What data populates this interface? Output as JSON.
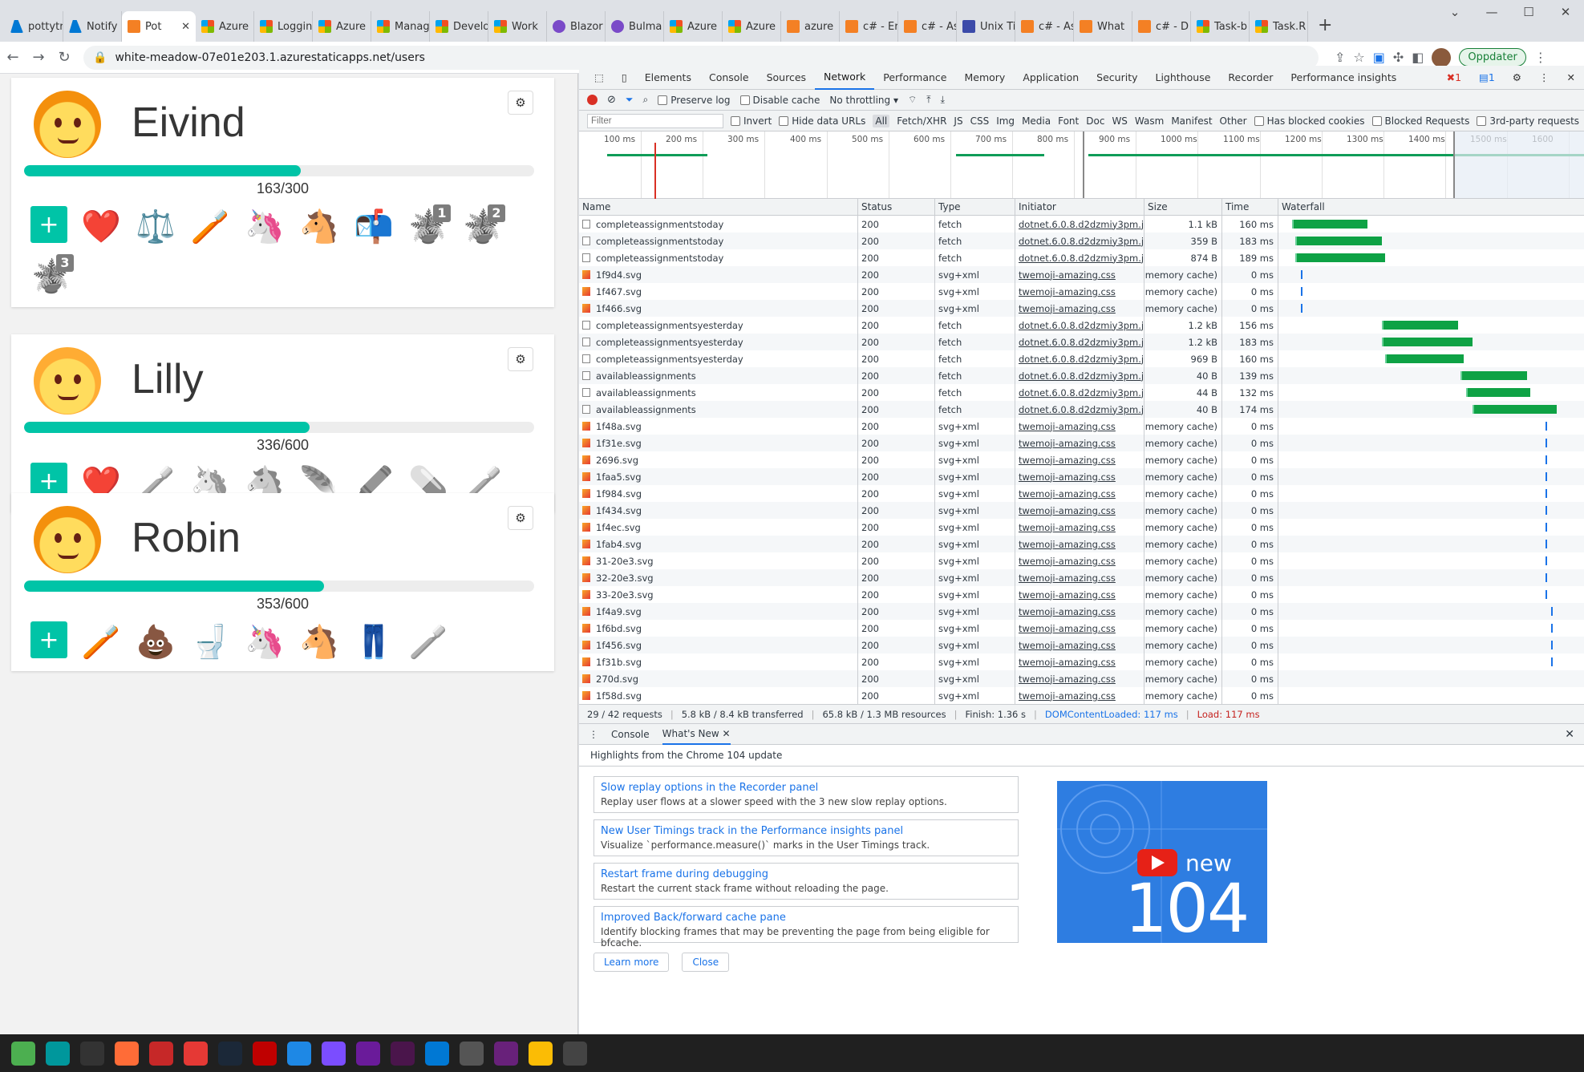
{
  "tabs": [
    {
      "label": "pottytr",
      "icon": "azure-icon"
    },
    {
      "label": "Notify",
      "icon": "azure-icon"
    },
    {
      "label": "Pot",
      "icon": "poop-icon",
      "active": true
    },
    {
      "label": "Azure",
      "icon": "microsoft-icon"
    },
    {
      "label": "Loggin",
      "icon": "microsoft-icon"
    },
    {
      "label": "Azure",
      "icon": "microsoft-icon"
    },
    {
      "label": "Manag",
      "icon": "microsoft-icon"
    },
    {
      "label": "Develo",
      "icon": "microsoft-icon"
    },
    {
      "label": "Work",
      "icon": "microsoft-icon"
    },
    {
      "label": "Blazor",
      "icon": "blazor-icon"
    },
    {
      "label": "Bulma",
      "icon": "bulma-icon"
    },
    {
      "label": "Azure",
      "icon": "microsoft-icon"
    },
    {
      "label": "Azure",
      "icon": "microsoft-icon"
    },
    {
      "label": "azure",
      "icon": "stackoverflow-icon"
    },
    {
      "label": "c# - Er",
      "icon": "stackoverflow-icon"
    },
    {
      "label": "c# - As",
      "icon": "stackoverflow-icon"
    },
    {
      "label": "Unix Ti",
      "icon": "unix-icon"
    },
    {
      "label": "c# - As",
      "icon": "stackoverflow-icon"
    },
    {
      "label": "What",
      "icon": "stackoverflow-icon"
    },
    {
      "label": "c# - D",
      "icon": "stackoverflow-icon"
    },
    {
      "label": "Task-b",
      "icon": "microsoft-icon"
    },
    {
      "label": "Task.R",
      "icon": "microsoft-icon"
    }
  ],
  "url": "white-meadow-07e01e203.1.azurestaticapps.net/users",
  "update_label": "Oppdater",
  "users": [
    {
      "name": "Eivind",
      "score": "163/300",
      "progress": 0.543,
      "hair": "#f4900c",
      "icons": [
        "heart-sun",
        "balance-scale",
        "toothbrush",
        "unicorn",
        "horse",
        "mailbox",
        "potty-1",
        "potty-2",
        "potty-3"
      ]
    },
    {
      "name": "Lilly",
      "score": "336/600",
      "progress": 0.56,
      "hair": "#ffac33",
      "icons": [
        "heart-sun",
        "toothbrush-gray",
        "unicorn-gray",
        "horse-gray",
        "feather-gray",
        "crayon-gray",
        "pill-gray",
        "toothbrush-gray-2"
      ]
    },
    {
      "name": "Robin",
      "score": "353/600",
      "progress": 0.588,
      "hair": "#f4900c",
      "icons": [
        "toothbrush",
        "poop",
        "toilet",
        "unicorn",
        "horse",
        "jeans",
        "toothbrush-gray-2"
      ]
    }
  ],
  "devtools": {
    "tabs": [
      "Elements",
      "Console",
      "Sources",
      "Network",
      "Performance",
      "Memory",
      "Application",
      "Security",
      "Lighthouse",
      "Recorder",
      "Performance insights"
    ],
    "active_tab": "Network",
    "errors": "1",
    "messages": "1",
    "preserve_log": "Preserve log",
    "disable_cache": "Disable cache",
    "throttling": "No throttling",
    "filter_placeholder": "Filter",
    "invert": "Invert",
    "hide_data": "Hide data URLs",
    "types": [
      "All",
      "Fetch/XHR",
      "JS",
      "CSS",
      "Img",
      "Media",
      "Font",
      "Doc",
      "WS",
      "Wasm",
      "Manifest",
      "Other"
    ],
    "has_blocked": "Has blocked cookies",
    "blocked_req": "Blocked Requests",
    "third_party": "3rd-party requests",
    "timeline_ticks": [
      "100 ms",
      "200 ms",
      "300 ms",
      "400 ms",
      "500 ms",
      "600 ms",
      "700 ms",
      "800 ms",
      "900 ms",
      "1000 ms",
      "1100 ms",
      "1200 ms",
      "1300 ms",
      "1400 ms",
      "1500 ms",
      "1600"
    ],
    "columns": [
      "Name",
      "Status",
      "Type",
      "Initiator",
      "Size",
      "Time",
      "Waterfall"
    ],
    "rows": [
      {
        "name": "completeassignmentstoday",
        "status": "200",
        "type": "fetch",
        "initiator": "dotnet.6.0.8.d2dzmiy3pm.j...",
        "size": "1.1 kB",
        "time": "160 ms",
        "start": 0.02,
        "dur": 0.26,
        "kind": "doc"
      },
      {
        "name": "completeassignmentstoday",
        "status": "200",
        "type": "fetch",
        "initiator": "dotnet.6.0.8.d2dzmiy3pm.j...",
        "size": "359 B",
        "time": "183 ms",
        "start": 0.03,
        "dur": 0.3,
        "kind": "doc"
      },
      {
        "name": "completeassignmentstoday",
        "status": "200",
        "type": "fetch",
        "initiator": "dotnet.6.0.8.d2dzmiy3pm.j...",
        "size": "874 B",
        "time": "189 ms",
        "start": 0.03,
        "dur": 0.31,
        "kind": "doc"
      },
      {
        "name": "1f9d4.svg",
        "status": "200",
        "type": "svg+xml",
        "initiator": "twemoji-amazing.css",
        "size": "(memory cache)",
        "time": "0 ms",
        "start": 0.04,
        "dur": 0,
        "kind": "img"
      },
      {
        "name": "1f467.svg",
        "status": "200",
        "type": "svg+xml",
        "initiator": "twemoji-amazing.css",
        "size": "(memory cache)",
        "time": "0 ms",
        "start": 0.04,
        "dur": 0,
        "kind": "img"
      },
      {
        "name": "1f466.svg",
        "status": "200",
        "type": "svg+xml",
        "initiator": "twemoji-amazing.css",
        "size": "(memory cache)",
        "time": "0 ms",
        "start": 0.04,
        "dur": 0,
        "kind": "img"
      },
      {
        "name": "completeassignmentsyesterday",
        "status": "200",
        "type": "fetch",
        "initiator": "dotnet.6.0.8.d2dzmiy3pm.j...",
        "size": "1.2 kB",
        "time": "156 ms",
        "start": 0.33,
        "dur": 0.26,
        "kind": "doc"
      },
      {
        "name": "completeassignmentsyesterday",
        "status": "200",
        "type": "fetch",
        "initiator": "dotnet.6.0.8.d2dzmiy3pm.j...",
        "size": "1.2 kB",
        "time": "183 ms",
        "start": 0.33,
        "dur": 0.31,
        "kind": "doc"
      },
      {
        "name": "completeassignmentsyesterday",
        "status": "200",
        "type": "fetch",
        "initiator": "dotnet.6.0.8.d2dzmiy3pm.j...",
        "size": "969 B",
        "time": "160 ms",
        "start": 0.34,
        "dur": 0.27,
        "kind": "doc"
      },
      {
        "name": "availableassignments",
        "status": "200",
        "type": "fetch",
        "initiator": "dotnet.6.0.8.d2dzmiy3pm.j...",
        "size": "40 B",
        "time": "139 ms",
        "start": 0.6,
        "dur": 0.23,
        "kind": "doc"
      },
      {
        "name": "availableassignments",
        "status": "200",
        "type": "fetch",
        "initiator": "dotnet.6.0.8.d2dzmiy3pm.j...",
        "size": "44 B",
        "time": "132 ms",
        "start": 0.62,
        "dur": 0.22,
        "kind": "doc"
      },
      {
        "name": "availableassignments",
        "status": "200",
        "type": "fetch",
        "initiator": "dotnet.6.0.8.d2dzmiy3pm.j...",
        "size": "40 B",
        "time": "174 ms",
        "start": 0.64,
        "dur": 0.29,
        "kind": "doc"
      },
      {
        "name": "1f48a.svg",
        "status": "200",
        "type": "svg+xml",
        "initiator": "twemoji-amazing.css",
        "size": "(memory cache)",
        "time": "0 ms",
        "start": 0.88,
        "dur": 0,
        "kind": "img"
      },
      {
        "name": "1f31e.svg",
        "status": "200",
        "type": "svg+xml",
        "initiator": "twemoji-amazing.css",
        "size": "(memory cache)",
        "time": "0 ms",
        "start": 0.88,
        "dur": 0,
        "kind": "img"
      },
      {
        "name": "2696.svg",
        "status": "200",
        "type": "svg+xml",
        "initiator": "twemoji-amazing.css",
        "size": "(memory cache)",
        "time": "0 ms",
        "start": 0.88,
        "dur": 0,
        "kind": "img"
      },
      {
        "name": "1faa5.svg",
        "status": "200",
        "type": "svg+xml",
        "initiator": "twemoji-amazing.css",
        "size": "(memory cache)",
        "time": "0 ms",
        "start": 0.88,
        "dur": 0,
        "kind": "img"
      },
      {
        "name": "1f984.svg",
        "status": "200",
        "type": "svg+xml",
        "initiator": "twemoji-amazing.css",
        "size": "(memory cache)",
        "time": "0 ms",
        "start": 0.88,
        "dur": 0,
        "kind": "img"
      },
      {
        "name": "1f434.svg",
        "status": "200",
        "type": "svg+xml",
        "initiator": "twemoji-amazing.css",
        "size": "(memory cache)",
        "time": "0 ms",
        "start": 0.88,
        "dur": 0,
        "kind": "img"
      },
      {
        "name": "1f4ec.svg",
        "status": "200",
        "type": "svg+xml",
        "initiator": "twemoji-amazing.css",
        "size": "(memory cache)",
        "time": "0 ms",
        "start": 0.88,
        "dur": 0,
        "kind": "img"
      },
      {
        "name": "1fab4.svg",
        "status": "200",
        "type": "svg+xml",
        "initiator": "twemoji-amazing.css",
        "size": "(memory cache)",
        "time": "0 ms",
        "start": 0.88,
        "dur": 0,
        "kind": "img"
      },
      {
        "name": "31-20e3.svg",
        "status": "200",
        "type": "svg+xml",
        "initiator": "twemoji-amazing.css",
        "size": "(memory cache)",
        "time": "0 ms",
        "start": 0.88,
        "dur": 0,
        "kind": "img"
      },
      {
        "name": "32-20e3.svg",
        "status": "200",
        "type": "svg+xml",
        "initiator": "twemoji-amazing.css",
        "size": "(memory cache)",
        "time": "0 ms",
        "start": 0.88,
        "dur": 0,
        "kind": "img"
      },
      {
        "name": "33-20e3.svg",
        "status": "200",
        "type": "svg+xml",
        "initiator": "twemoji-amazing.css",
        "size": "(memory cache)",
        "time": "0 ms",
        "start": 0.88,
        "dur": 0,
        "kind": "img"
      },
      {
        "name": "1f4a9.svg",
        "status": "200",
        "type": "svg+xml",
        "initiator": "twemoji-amazing.css",
        "size": "(memory cache)",
        "time": "0 ms",
        "start": 0.9,
        "dur": 0,
        "kind": "img"
      },
      {
        "name": "1f6bd.svg",
        "status": "200",
        "type": "svg+xml",
        "initiator": "twemoji-amazing.css",
        "size": "(memory cache)",
        "time": "0 ms",
        "start": 0.9,
        "dur": 0,
        "kind": "img"
      },
      {
        "name": "1f456.svg",
        "status": "200",
        "type": "svg+xml",
        "initiator": "twemoji-amazing.css",
        "size": "(memory cache)",
        "time": "0 ms",
        "start": 0.9,
        "dur": 0,
        "kind": "img"
      },
      {
        "name": "1f31b.svg",
        "status": "200",
        "type": "svg+xml",
        "initiator": "twemoji-amazing.css",
        "size": "(memory cache)",
        "time": "0 ms",
        "start": 0.9,
        "dur": 0,
        "kind": "img"
      },
      {
        "name": "270d.svg",
        "status": "200",
        "type": "svg+xml",
        "initiator": "twemoji-amazing.css",
        "size": "(memory cache)",
        "time": "0 ms",
        "start": 0.99,
        "dur": 0,
        "kind": "img"
      },
      {
        "name": "1f58d.svg",
        "status": "200",
        "type": "svg+xml",
        "initiator": "twemoji-amazing.css",
        "size": "(memory cache)",
        "time": "0 ms",
        "start": 0.99,
        "dur": 0,
        "kind": "img"
      }
    ],
    "summary": {
      "requests": "29 / 42 requests",
      "transferred": "5.8 kB / 8.4 kB transferred",
      "resources": "65.8 kB / 1.3 MB resources",
      "finish": "Finish: 1.36 s",
      "dcl": "DOMContentLoaded: 117 ms",
      "load": "Load: 117 ms"
    },
    "drawer_tabs": [
      "Console",
      "What's New"
    ],
    "highlights": "Highlights from the Chrome 104 update",
    "features": [
      {
        "title": "Slow replay options in the Recorder panel",
        "desc": "Replay user flows at a slower speed with the 3 new slow replay options."
      },
      {
        "title": "New User Timings track in the Performance insights panel",
        "desc": "Visualize `performance.measure()` marks in the User Timings track."
      },
      {
        "title": "Restart frame during debugging",
        "desc": "Restart the current stack frame without reloading the page."
      },
      {
        "title": "Improved Back/forward cache pane",
        "desc": "Identify blocking frames that may be preventing the page from being eligible for bfcache."
      }
    ],
    "thumb_new": "new",
    "thumb_ver": "104",
    "learn_more": "Learn more",
    "close": "Close"
  },
  "colors": {
    "accent": "#00c4a7",
    "devtools_blue": "#1a73e8",
    "waterfall_green": "#0ea245"
  }
}
